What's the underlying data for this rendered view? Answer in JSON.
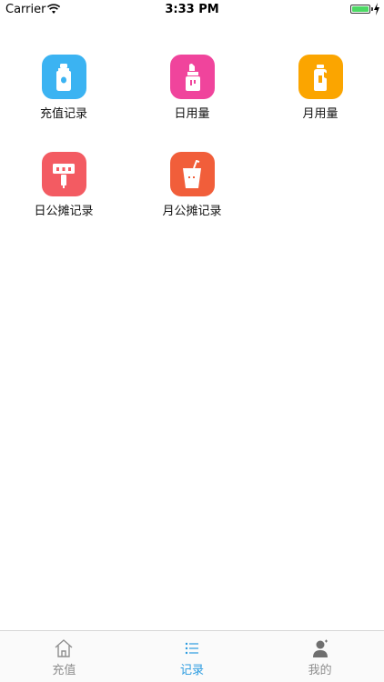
{
  "status_bar": {
    "carrier": "Carrier",
    "time": "3:33 PM",
    "battery_level": 1.0
  },
  "grid": {
    "items": [
      {
        "label": "充值记录",
        "color": "#3bb3f2",
        "icon": "baby-bottle-icon"
      },
      {
        "label": "日用量",
        "color": "#f0449c",
        "icon": "lipstick-bottle-icon"
      },
      {
        "label": "月用量",
        "color": "#fba500",
        "icon": "detergent-jug-icon"
      },
      {
        "label": "日公摊记录",
        "color": "#f35b62",
        "icon": "power-strip-icon"
      },
      {
        "label": "月公摊记录",
        "color": "#f15e3a",
        "icon": "cup-with-straw-icon"
      }
    ]
  },
  "tab_bar": {
    "tabs": [
      {
        "label": "充值",
        "icon": "home-icon",
        "active": false
      },
      {
        "label": "记录",
        "icon": "list-icon",
        "active": true
      },
      {
        "label": "我的",
        "icon": "user-icon",
        "active": false
      }
    ],
    "active_color": "#2a9be0",
    "inactive_color": "#8e8e8e"
  }
}
